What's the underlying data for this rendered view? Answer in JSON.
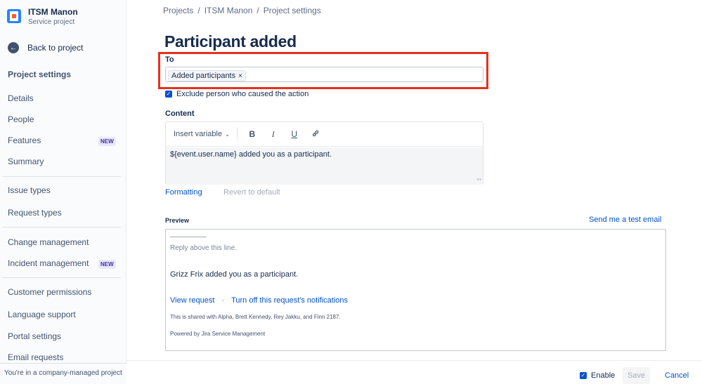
{
  "project": {
    "name": "ITSM Manon",
    "type": "Service project"
  },
  "sidebar": {
    "back_label": "Back to project",
    "heading": "Project settings",
    "items": [
      {
        "label": "Details"
      },
      {
        "label": "People"
      },
      {
        "label": "Features",
        "badge": "NEW"
      },
      {
        "label": "Summary"
      },
      {
        "label": "Issue types"
      },
      {
        "label": "Request types"
      },
      {
        "label": "Change management"
      },
      {
        "label": "Incident management",
        "badge": "NEW"
      },
      {
        "label": "Customer permissions"
      },
      {
        "label": "Language support"
      },
      {
        "label": "Portal settings"
      },
      {
        "label": "Email requests"
      }
    ],
    "footer": "You're in a company-managed project"
  },
  "breadcrumb": {
    "items": [
      "Projects",
      "ITSM Manon",
      "Project settings"
    ],
    "separator": "/"
  },
  "page": {
    "title": "Participant added"
  },
  "to": {
    "label": "To",
    "chip": "Added participants",
    "chip_remove": "×"
  },
  "exclude": {
    "label": "Exclude person who caused the action",
    "checked": true
  },
  "content": {
    "label": "Content",
    "insert_variable": "Insert variable",
    "bold": "B",
    "italic": "I",
    "underline": "U",
    "body": "${event.user.name} added you as a participant."
  },
  "links": {
    "formatting": "Formatting",
    "revert": "Revert to default"
  },
  "preview": {
    "label": "Preview",
    "send_test": "Send me a test email",
    "reply_above": "Reply above this line.",
    "message": "Grizz Frix added you as a participant.",
    "view_request": "View request",
    "dot": "·",
    "turn_off": "Turn off this request's notifications",
    "shared": "This is shared with Alpha, Brett Kennedy, Rey Jakku, and Finn 2187.",
    "powered": "Powered by Jira Service Management"
  },
  "footer": {
    "enable": "Enable",
    "enable_checked": true,
    "save": "Save",
    "cancel": "Cancel"
  },
  "colors": {
    "accent": "#0052cc",
    "highlight": "#e8301c",
    "text": "#172b4d"
  }
}
